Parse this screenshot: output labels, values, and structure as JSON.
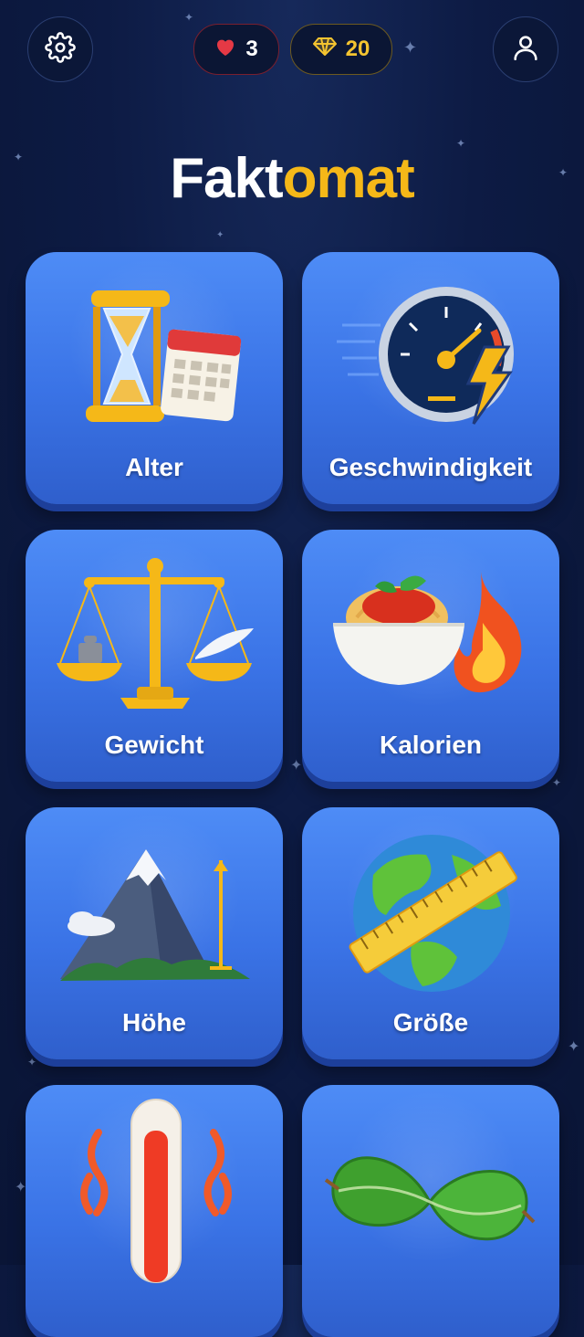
{
  "header": {
    "hearts": "3",
    "gems": "20"
  },
  "title": {
    "part1": "Fakt",
    "part2": "omat"
  },
  "categories": [
    {
      "label": "Alter"
    },
    {
      "label": "Geschwindigkeit"
    },
    {
      "label": "Gewicht"
    },
    {
      "label": "Kalorien"
    },
    {
      "label": "Höhe"
    },
    {
      "label": "Größe"
    },
    {
      "label": ""
    },
    {
      "label": ""
    }
  ],
  "colors": {
    "accent": "#f5b818",
    "card": "#3f7cec",
    "background": "#0d1b44",
    "heart": "#e53945"
  },
  "icons": [
    "gear-icon",
    "user-icon",
    "heart-icon",
    "diamond-icon"
  ]
}
